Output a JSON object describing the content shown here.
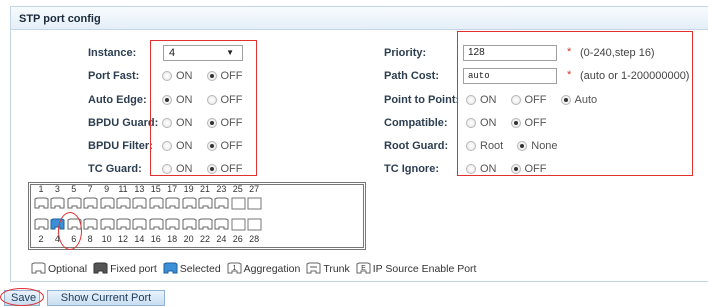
{
  "panel": {
    "title": "STP port config"
  },
  "left_fields": [
    {
      "label": "Instance:",
      "type": "select",
      "value": "4"
    },
    {
      "label": "Port Fast:",
      "type": "radio",
      "options": [
        "ON",
        "OFF"
      ],
      "selected": "OFF"
    },
    {
      "label": "Auto Edge:",
      "type": "radio",
      "options": [
        "ON",
        "OFF"
      ],
      "selected": "ON"
    },
    {
      "label": "BPDU Guard:",
      "type": "radio",
      "options": [
        "ON",
        "OFF"
      ],
      "selected": "OFF"
    },
    {
      "label": "BPDU Filter:",
      "type": "radio",
      "options": [
        "ON",
        "OFF"
      ],
      "selected": "OFF"
    },
    {
      "label": "TC Guard:",
      "type": "radio",
      "options": [
        "ON",
        "OFF"
      ],
      "selected": "OFF"
    }
  ],
  "right_fields": [
    {
      "label": "Priority:",
      "type": "text",
      "value": "128",
      "required": "*",
      "hint": "(0-240,step 16)"
    },
    {
      "label": "Path Cost:",
      "type": "text",
      "value": "auto",
      "required": "*",
      "hint": "(auto or 1-200000000)"
    },
    {
      "label": "Point to Point:",
      "type": "radio",
      "options": [
        "ON",
        "OFF",
        "Auto"
      ],
      "selected": "Auto"
    },
    {
      "label": "Compatible:",
      "type": "radio",
      "options": [
        "ON",
        "OFF"
      ],
      "selected": "OFF"
    },
    {
      "label": "Root Guard:",
      "type": "radio",
      "options": [
        "Root",
        "None"
      ],
      "selected": "None"
    },
    {
      "label": "TC Ignore:",
      "type": "radio",
      "options": [
        "ON",
        "OFF"
      ],
      "selected": "OFF"
    }
  ],
  "ports": {
    "top_numbers": [
      "1",
      "3",
      "5",
      "7",
      "9",
      "11",
      "13",
      "15",
      "17",
      "19",
      "21",
      "23",
      "25",
      "27"
    ],
    "bottom_numbers": [
      "2",
      "4",
      "6",
      "8",
      "10",
      "12",
      "14",
      "16",
      "18",
      "20",
      "22",
      "24",
      "26",
      "28"
    ],
    "selected_port": "4"
  },
  "legend": {
    "optional": "Optional",
    "fixed": "Fixed port",
    "selected": "Selected",
    "aggregation": "Aggregation",
    "trunk": "Trunk",
    "ip_source": "IP Source Enable Port",
    "aggregation_glyph": "1",
    "ip_source_glyph": "E"
  },
  "buttons": {
    "save": "Save",
    "show_current": "Show Current Port"
  },
  "colors": {
    "highlight": "#e03030",
    "selected_port": "#3b8fd6",
    "header_bg": "#e4eef7"
  }
}
